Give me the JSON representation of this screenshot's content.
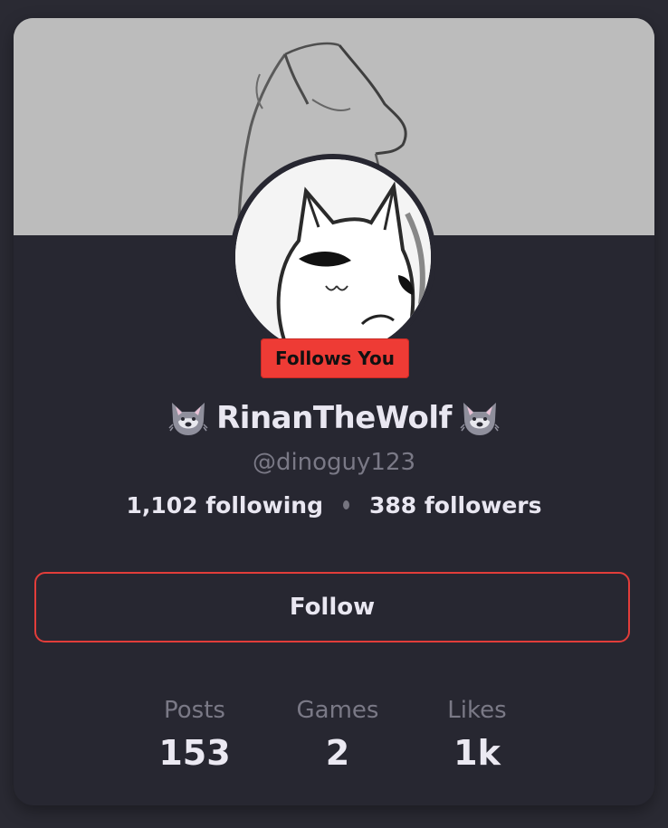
{
  "profile": {
    "display_name": "RinanTheWolf",
    "name_emoji": "wolf-emoji",
    "handle": "@dinoguy123",
    "follows_you_badge": "Follows You",
    "following": "1,102 following",
    "followers": "388 followers"
  },
  "actions": {
    "follow_label": "Follow"
  },
  "stats": [
    {
      "label": "Posts",
      "value": "153"
    },
    {
      "label": "Games",
      "value": "2"
    },
    {
      "label": "Likes",
      "value": "1k"
    }
  ],
  "colors": {
    "background": "#2a2a33",
    "card": "#272731",
    "accent_red": "#ee3b35",
    "text_primary": "#e9e7f1",
    "text_muted": "#7a7986"
  }
}
